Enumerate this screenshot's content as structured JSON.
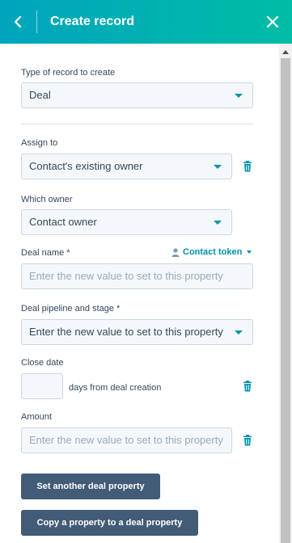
{
  "header": {
    "title": "Create record"
  },
  "record_type": {
    "label": "Type of record to create",
    "value": "Deal"
  },
  "assign_to": {
    "label": "Assign to",
    "value": "Contact's existing owner"
  },
  "which_owner": {
    "label": "Which owner",
    "value": "Contact owner"
  },
  "deal_name": {
    "label": "Deal name *",
    "placeholder": "Enter the new value to set to this property",
    "token_label": "Contact token"
  },
  "pipeline": {
    "label": "Deal pipeline and stage *",
    "placeholder": "Enter the new value to set to this property"
  },
  "close_date": {
    "label": "Close date",
    "value": "",
    "suffix": "days from deal creation"
  },
  "amount": {
    "label": "Amount",
    "placeholder": "Enter the new value to set to this property"
  },
  "buttons": {
    "set_another": "Set another deal property",
    "copy_property": "Copy a property to a deal property"
  },
  "colors": {
    "header_start": "#00a4bd",
    "header_end": "#00bda5",
    "accent": "#0091ae",
    "button": "#425b76"
  },
  "icons": [
    "chevron-left-icon",
    "close-icon",
    "trash-icon",
    "person-icon",
    "caret-down-icon"
  ]
}
